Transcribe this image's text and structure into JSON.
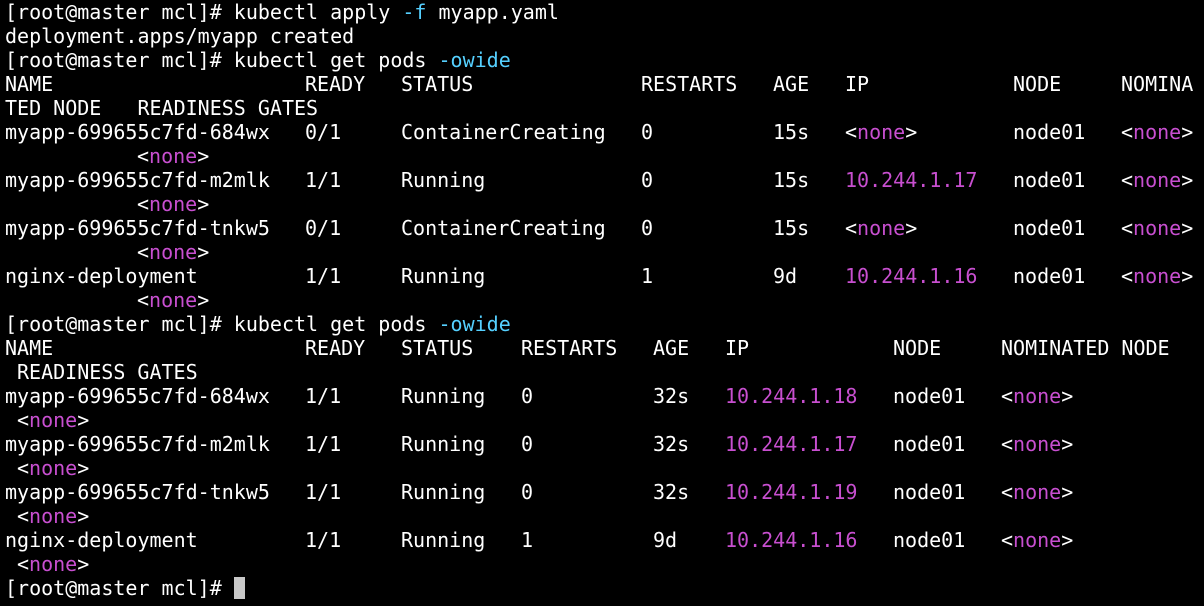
{
  "terminal": {
    "prompt": "[root@master mcl]# ",
    "commands": {
      "apply": {
        "base": "kubectl apply ",
        "flag": "-f",
        "rest": " myapp.yaml"
      },
      "get1": {
        "base": "kubectl get pods ",
        "flag": "-owide"
      },
      "get2": {
        "base": "kubectl get pods ",
        "flag": "-owide"
      }
    },
    "created_msg": "deployment.apps/myapp created"
  },
  "table1": {
    "headers": {
      "name": "NAME",
      "ready": "READY",
      "status": "STATUS",
      "restarts": "RESTARTS",
      "age": "AGE",
      "ip": "IP",
      "node": "NODE",
      "nomina": "NOMINA",
      "wrap": "TED NODE   READINESS GATES"
    },
    "rows": [
      {
        "name": "myapp-699655c7fd-684wx",
        "ready": "0/1",
        "status": "ContainerCreating",
        "restarts": "0",
        "age": "15s",
        "ip": "",
        "node": "node01"
      },
      {
        "name": "myapp-699655c7fd-m2mlk",
        "ready": "1/1",
        "status": "Running",
        "restarts": "0",
        "age": "15s",
        "ip": "10.244.1.17",
        "node": "node01"
      },
      {
        "name": "myapp-699655c7fd-tnkw5",
        "ready": "0/1",
        "status": "ContainerCreating",
        "restarts": "0",
        "age": "15s",
        "ip": "",
        "node": "node01"
      },
      {
        "name": "nginx-deployment",
        "ready": "1/1",
        "status": "Running",
        "restarts": "1",
        "age": "9d",
        "ip": "10.244.1.16",
        "node": "node01"
      }
    ]
  },
  "table2": {
    "headers": {
      "name": "NAME",
      "ready": "READY",
      "status": "STATUS",
      "restarts": "RESTARTS",
      "age": "AGE",
      "ip": "IP",
      "node": "NODE",
      "nominated": "NOMINATED NODE",
      "wrap": "READINESS GATES"
    },
    "rows": [
      {
        "name": "myapp-699655c7fd-684wx",
        "ready": "1/1",
        "status": "Running",
        "restarts": "0",
        "age": "32s",
        "ip": "10.244.1.18",
        "node": "node01"
      },
      {
        "name": "myapp-699655c7fd-m2mlk",
        "ready": "1/1",
        "status": "Running",
        "restarts": "0",
        "age": "32s",
        "ip": "10.244.1.17",
        "node": "node01"
      },
      {
        "name": "myapp-699655c7fd-tnkw5",
        "ready": "1/1",
        "status": "Running",
        "restarts": "0",
        "age": "32s",
        "ip": "10.244.1.19",
        "node": "node01"
      },
      {
        "name": "nginx-deployment",
        "ready": "1/1",
        "status": "Running",
        "restarts": "1",
        "age": "9d",
        "ip": "10.244.1.16",
        "node": "node01"
      }
    ]
  },
  "none_text": "none",
  "colors": {
    "background": "#000000",
    "text": "#ffffff",
    "flag": "#55d0ff",
    "value": "#c84fd0",
    "cursor": "#c8c8c8"
  }
}
